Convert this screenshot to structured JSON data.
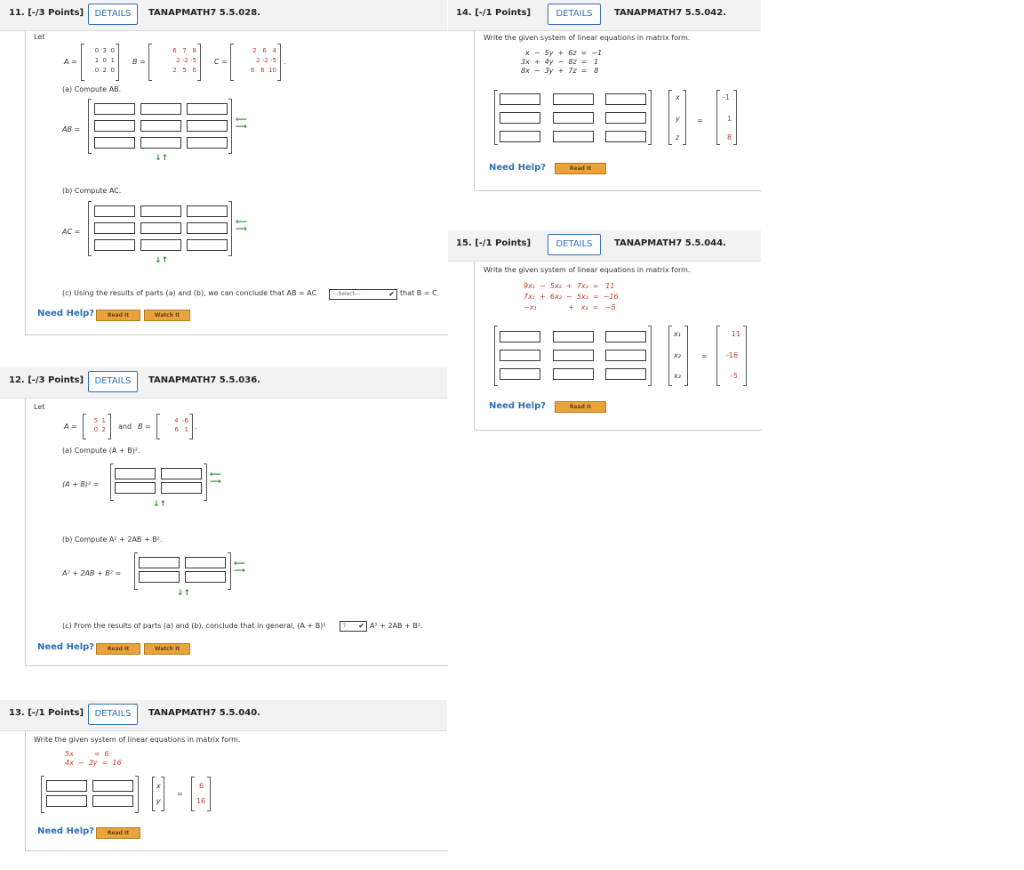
{
  "q11": {
    "number": "11. [-/3 Points]",
    "details": "DETAILS",
    "code": "TANAPMATH7 5.5.028.",
    "let": "Let",
    "A_label": "A =",
    "B_label": "B =",
    "C_label": "C =",
    "A": [
      [
        "0",
        "3",
        "0"
      ],
      [
        "1",
        "0",
        "1"
      ],
      [
        "0",
        "2",
        "0"
      ]
    ],
    "B": [
      [
        "6",
        "7",
        "8"
      ],
      [
        "2",
        "-2",
        "-5"
      ],
      [
        "2",
        "5",
        "6"
      ]
    ],
    "C": [
      [
        "2",
        "6",
        "4"
      ],
      [
        "2",
        "-2",
        "-5"
      ],
      [
        "6",
        "6",
        "10"
      ]
    ],
    "part_a": "(a) Compute AB.",
    "AB_label": "AB =",
    "part_b": "(b) Compute AC.",
    "AC_label": "AC =",
    "part_c_pre": "(c) Using the results of parts (a) and (b), we can conclude that AB = AC",
    "part_c_select": "---Select---",
    "part_c_post": "that B = C.",
    "need_help": "Need Help?",
    "read_it": "Read It",
    "watch_it": "Watch It"
  },
  "q12": {
    "number": "12. [-/3 Points]",
    "details": "DETAILS",
    "code": "TANAPMATH7 5.5.036.",
    "let": "Let",
    "A_label": "A =",
    "and": "and",
    "B_label": "B =",
    "A": [
      [
        "5",
        "1"
      ],
      [
        "0",
        "2"
      ]
    ],
    "B": [
      [
        "4",
        "-6"
      ],
      [
        "6",
        "1"
      ]
    ],
    "part_a": "(a) Compute (A + B)².",
    "ApB_label": "(A + B)² =",
    "part_b": "(b) Compute A² + 2AB + B².",
    "sum_label": "A² + 2AB + B² =",
    "part_c_pre": "(c) From the results of parts (a) and (b), conclude that in general, (A + B)²",
    "part_c_select": "?",
    "part_c_post": "A² + 2AB + B².",
    "need_help": "Need Help?",
    "read_it": "Read It",
    "watch_it": "Watch It"
  },
  "q13": {
    "number": "13. [-/1 Points]",
    "details": "DETAILS",
    "code": "TANAPMATH7 5.5.040.",
    "prompt": "Write the given system of linear equations in matrix form.",
    "eq1": "5x         =  6",
    "eq2": "4x  −  2y  =  16",
    "vars": [
      "x",
      "y"
    ],
    "eq_sign": "=",
    "rhs": [
      "6",
      "16"
    ],
    "need_help": "Need Help?",
    "read_it": "Read It"
  },
  "q14": {
    "number": "14. [-/1 Points]",
    "details": "DETAILS",
    "code": "TANAPMATH7 5.5.042.",
    "prompt": "Write the given system of linear equations in matrix form.",
    "eq1": "x  −  5y  +  6z  =  −1",
    "eq2": "3x  +  4y  −  8z  =   1",
    "eq3": "8x  −  3y  +  7z  =   8",
    "vars": [
      "x",
      "y",
      "z"
    ],
    "eq_sign": "=",
    "rhs": [
      "-1",
      "1",
      "8"
    ],
    "need_help": "Need Help?",
    "read_it": "Read It"
  },
  "q15": {
    "number": "15. [-/1 Points]",
    "details": "DETAILS",
    "code": "TANAPMATH7 5.5.044.",
    "prompt": "Write the given system of linear equations in matrix form.",
    "eq1": "9x₁  −  5x₂  +  7x₃  =   11",
    "eq2": "7x₁  +  6x₂  −  5x₃  =  −16",
    "eq3": "−x₁              +   x₃  =   −5",
    "vars": [
      "x₁",
      "x₂",
      "x₃"
    ],
    "eq_sign": "=",
    "rhs": [
      "11",
      "-16",
      "-5"
    ],
    "need_help": "Need Help?",
    "read_it": "Read It"
  },
  "colors": {
    "accent": "#2f6fb5",
    "help_button": "#e8a33d",
    "header_bg": "#f2f2f2",
    "arrow": "#2a8a2a",
    "red_text": "#c0392b"
  }
}
